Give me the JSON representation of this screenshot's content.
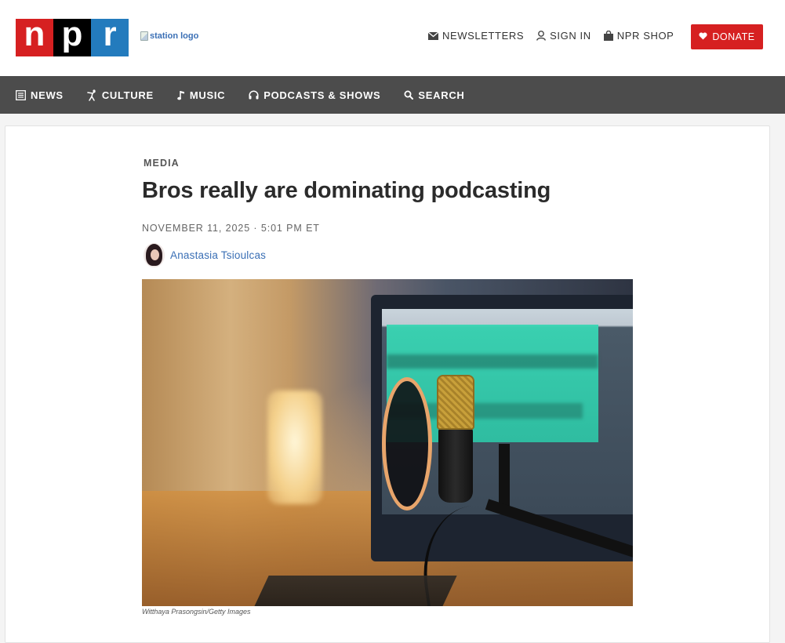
{
  "header": {
    "logo_letters": [
      "n",
      "p",
      "r"
    ],
    "station_logo_alt": "station logo",
    "utility_nav": [
      {
        "label": "NEWSLETTERS",
        "icon": "envelope-icon"
      },
      {
        "label": "SIGN IN",
        "icon": "user-icon"
      },
      {
        "label": "NPR SHOP",
        "icon": "shopping-bag-icon"
      }
    ],
    "donate_label": "DONATE"
  },
  "main_nav": [
    {
      "label": "NEWS",
      "icon": "newspaper-icon"
    },
    {
      "label": "CULTURE",
      "icon": "dancer-icon"
    },
    {
      "label": "MUSIC",
      "icon": "music-note-icon"
    },
    {
      "label": "PODCASTS & SHOWS",
      "icon": "headphones-icon"
    },
    {
      "label": "SEARCH",
      "icon": "search-icon"
    }
  ],
  "article": {
    "slug": "MEDIA",
    "headline": "Bros really are dominating podcasting",
    "dateline": "NOVEMBER 11, 2025 · 5:01 PM ET",
    "author": "Anastasia Tsioulcas",
    "image_credit": "Witthaya Prasongsin/Getty Images"
  },
  "colors": {
    "npr_red": "#d62021",
    "npr_black": "#000000",
    "npr_blue": "#237bbd",
    "nav_bg": "#4c4c4c",
    "link_blue": "#3a6fb5"
  }
}
